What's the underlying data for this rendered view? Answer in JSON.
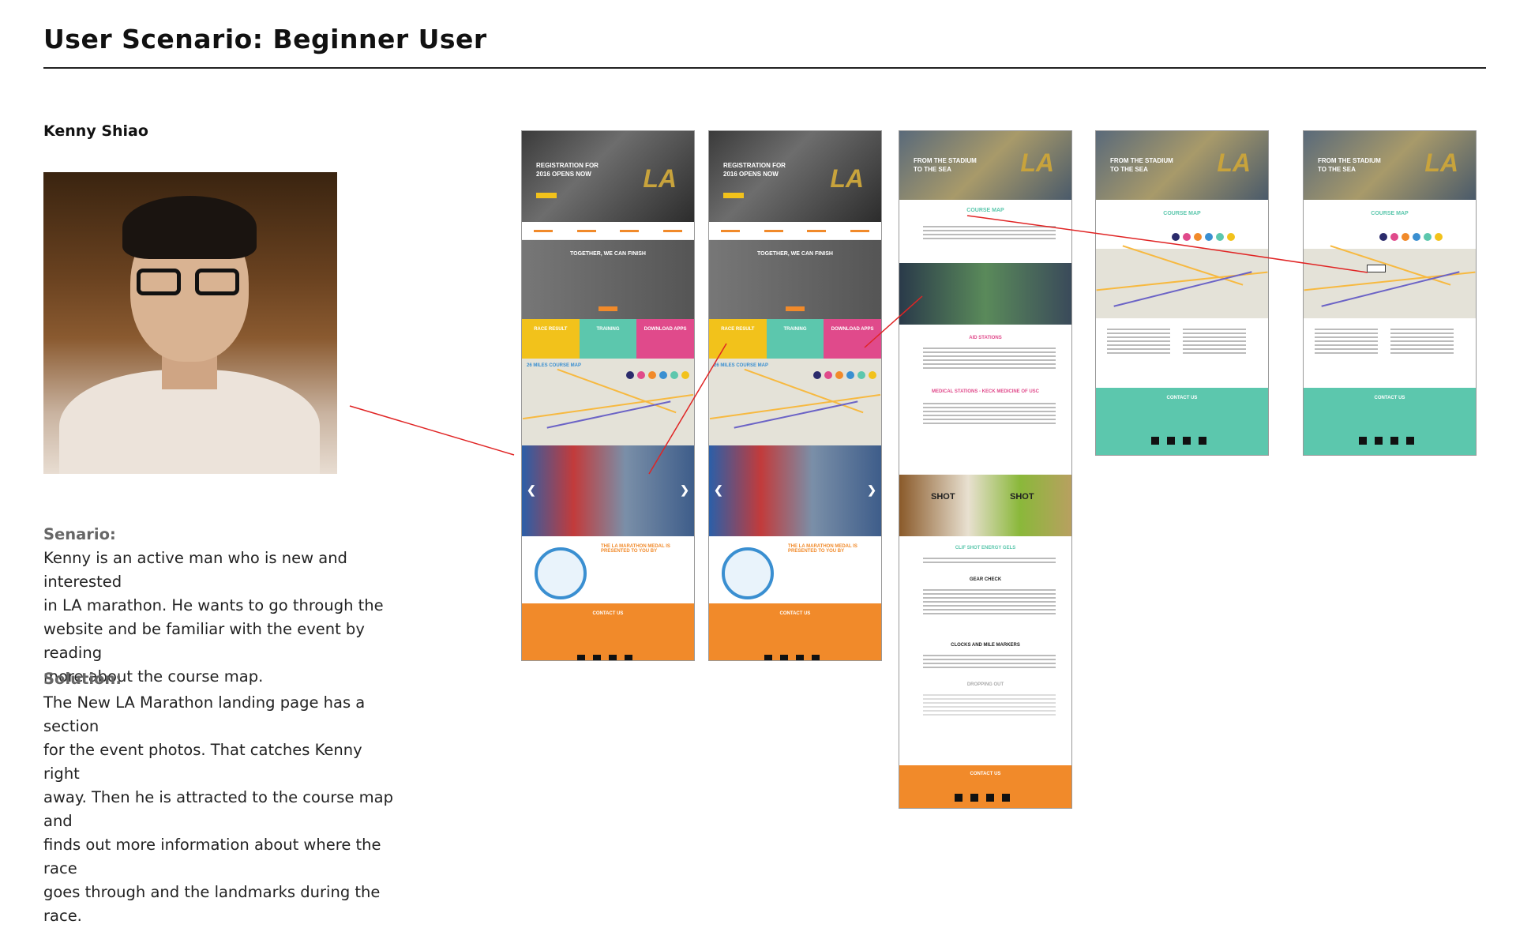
{
  "header": {
    "title": "User Scenario:  Beginner User"
  },
  "persona": {
    "name": "Kenny Shiao"
  },
  "scenario": {
    "heading": "Senario:",
    "lines": [
      "Kenny is an active man who is new and interested",
      "in LA marathon. He wants to go through the",
      "website and be familiar with the event by reading",
      "more about the course map."
    ]
  },
  "solution": {
    "heading": "Solution:",
    "lines": [
      "The New LA Marathon landing page has a section",
      "for the event photos. That catches Kenny right",
      "away. Then he is attracted to the course map and",
      "finds out more information about where the race",
      "goes through and the landmarks during the race."
    ]
  },
  "mock": {
    "hero_text": "REGISTRATION FOR 2016 OPENS NOW",
    "hero_logo": "LA",
    "together": "TOGETHER, WE CAN FINISH",
    "tiles": [
      "RACE RESULT",
      "TRAINING",
      "DOWNLOAD APPS"
    ],
    "course_map_26": "26 MILES COURSE MAP",
    "medal_text": "THE LA MARATHON MEDAL IS PRESENTED TO YOU BY",
    "contact": "CONTACT US",
    "stadium": "FROM THE STADIUM TO THE SEA",
    "course_map": "COURSE MAP",
    "aid": "AID STATIONS",
    "medical": "MEDICAL STATIONS - KECK MEDICINE OF USC",
    "clif": "CLIF SHOT ENERGY GELS",
    "gear": "GEAR CHECK",
    "clocks": "CLOCKS AND MILE MARKERS",
    "dropping": "DROPPING OUT",
    "shot": "SHOT"
  },
  "colors": {
    "accent_red": "#e02424",
    "orange": "#f18a2a",
    "teal": "#5cc7ad",
    "yellow": "#f2c21b",
    "pink": "#e04a8b"
  }
}
